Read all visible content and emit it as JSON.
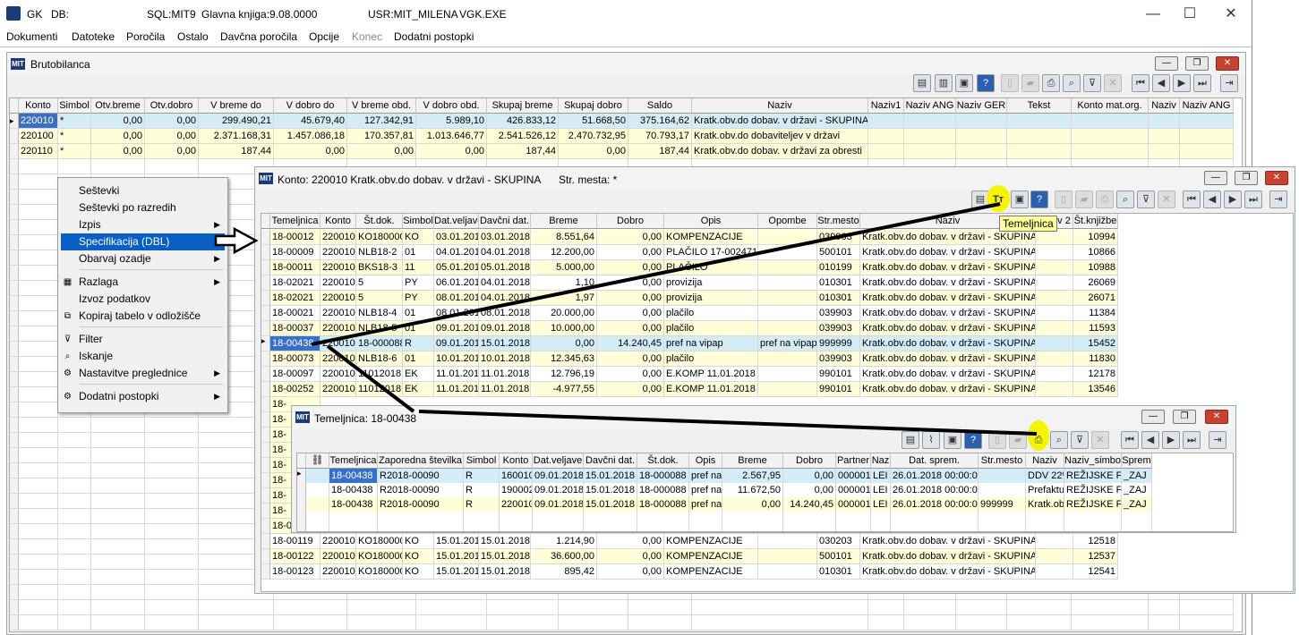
{
  "app": {
    "title_app": "GK",
    "title_db": "DB:",
    "title_sql": "SQL:MIT9",
    "title_ledger": "Glavna knjiga:9.08.0000",
    "title_user": "USR:MIT_MILENA",
    "title_exe": "VGK.EXE",
    "minimize": "—",
    "maximize": "☐",
    "close": "✕"
  },
  "menu": [
    "Dokumenti",
    "Datoteke",
    "Poročila",
    "Ostalo",
    "Davčna poročila",
    "Opcije",
    "Konec",
    "Dodatni postopki"
  ],
  "bruto": {
    "title": "Brutobilanca",
    "columns": [
      "Konto",
      "Simbol",
      "Otv.breme",
      "Otv.dobro",
      "V breme do",
      "V dobro do",
      "V breme obd.",
      "V dobro obd.",
      "Skupaj breme",
      "Skupaj dobro",
      "Saldo",
      "Naziv",
      "Naziv1",
      "Naziv ANG",
      "Naziv GER",
      "Tekst",
      "Konto mat.org.",
      "Naziv",
      "Naziv ANG"
    ],
    "rows": [
      [
        "220010",
        "*",
        "0,00",
        "0,00",
        "299.490,21",
        "45.679,40",
        "127.342,91",
        "5.989,10",
        "426.833,12",
        "51.668,50",
        "375.164,62",
        "Kratk.obv.do dobav. v državi - SKUPINA"
      ],
      [
        "220100",
        "*",
        "0,00",
        "0,00",
        "2.371.168,31",
        "1.457.086,18",
        "170.357,81",
        "1.013.646,77",
        "2.541.526,12",
        "2.470.732,95",
        "70.793,17",
        "Kratk.obv.do dobaviteljev v državi"
      ],
      [
        "220110",
        "*",
        "0,00",
        "0,00",
        "187,44",
        "0,00",
        "0,00",
        "0,00",
        "187,44",
        "0,00",
        "187,44",
        "Kratk.obv.do dobav. v državi za obresti"
      ]
    ]
  },
  "context_menu": {
    "items": [
      "Seštevki",
      "Seštevki po razredih",
      "Izpis",
      "Specifikacija (DBL)",
      "Obarvaj ozadje",
      "Razlaga",
      "Izvoz podatkov",
      "Kopiraj tabelo v odložišče",
      "Filter",
      "Iskanje",
      "Nastavitve preglednice",
      "Dodatni postopki"
    ]
  },
  "konto": {
    "title": "Konto: 220010 Kratk.obv.do dobav. v državi - SKUPINA",
    "str_mesta": "Str. mesta: *",
    "tooltip": "Temeljnica",
    "columns": [
      "Temeljnica",
      "Konto",
      "Št.dok.",
      "Simbol",
      "Dat.veljave",
      "Davčni dat.",
      "Breme",
      "Dobro",
      "Opis",
      "Opombe",
      "Str.mesto",
      "Naziv",
      "Naziv 2",
      "Št.knjižbe"
    ],
    "rows": [
      [
        "18-00012",
        "220010",
        "KO18000001",
        "KO",
        "03.01.2018",
        "03.01.2018",
        "8.551,64",
        "0,00",
        "KOMPENZACIJE",
        "",
        "039903",
        "Kratk.obv.do dobav. v državi - SKUPINA",
        "",
        "10994"
      ],
      [
        "18-00009",
        "220010",
        "NLB18-2",
        "01",
        "04.01.2018",
        "04.01.2018",
        "12.200,00",
        "0,00",
        "PLAČILO 17-002471",
        "",
        "500101",
        "Kratk.obv.do dobav. v državi - SKUPINA",
        "",
        "10866"
      ],
      [
        "18-00011",
        "220010",
        "BKS18-3",
        "11",
        "05.01.2018",
        "05.01.2018",
        "5.000,00",
        "0,00",
        "PLAČILO",
        "",
        "010199",
        "Kratk.obv.do dobav. v državi - SKUPINA",
        "",
        "10988"
      ],
      [
        "18-02021",
        "220010",
        "5",
        "PY",
        "06.01.2018",
        "04.01.2018",
        "1,10",
        "0,00",
        "provizija",
        "",
        "010301",
        "Kratk.obv.do dobav. v državi - SKUPINA",
        "",
        "26069"
      ],
      [
        "18-02021",
        "220010",
        "5",
        "PY",
        "08.01.2018",
        "04.01.2018",
        "1,97",
        "0,00",
        "provizija",
        "",
        "010301",
        "Kratk.obv.do dobav. v državi - SKUPINA",
        "",
        "26071"
      ],
      [
        "18-00021",
        "220010",
        "NLB18-4",
        "01",
        "08.01.2018",
        "08.01.2018",
        "20.000,00",
        "0,00",
        "plačilo",
        "",
        "039903",
        "Kratk.obv.do dobav. v državi - SKUPINA",
        "",
        "11384"
      ],
      [
        "18-00037",
        "220010",
        "NLB18-5",
        "01",
        "09.01.2018",
        "09.01.2018",
        "10.000,00",
        "0,00",
        "plačilo",
        "",
        "039903",
        "Kratk.obv.do dobav. v državi - SKUPINA",
        "",
        "11593"
      ],
      [
        "18-00438",
        "220010",
        "18-000088",
        "R",
        "09.01.2018",
        "15.01.2018",
        "0,00",
        "14.240,45",
        "pref na vipap",
        "pref na vipap",
        "999999",
        "Kratk.obv.do dobav. v državi - SKUPINA",
        "",
        "15452"
      ],
      [
        "18-00073",
        "220010",
        "NLB18-6",
        "01",
        "10.01.2018",
        "10.01.2018",
        "12.345,63",
        "0,00",
        "plačilo",
        "",
        "039903",
        "Kratk.obv.do dobav. v državi - SKUPINA",
        "",
        "11830"
      ],
      [
        "18-00097",
        "220010",
        "11012018",
        "EK",
        "11.01.2018",
        "11.01.2018",
        "12.796,19",
        "0,00",
        "E.KOMP 11.01.2018",
        "",
        "990101",
        "Kratk.obv.do dobav. v državi - SKUPINA",
        "",
        "12178"
      ],
      [
        "18-00252",
        "220010",
        "11012018",
        "EK",
        "11.01.2018",
        "11.01.2018",
        "-4.977,55",
        "0,00",
        "E.KOMP 11.01.2018",
        "",
        "990101",
        "Kratk.obv.do dobav. v državi - SKUPINA",
        "",
        "13546"
      ]
    ],
    "rows_bottom": [
      [
        "18-00119",
        "220010",
        "KO18000065",
        "KO",
        "15.01.2018",
        "15.01.2018",
        "1.138,76",
        "0,00",
        "KOMPENZACIJE",
        "",
        "010703",
        "Kratk.obv.do dobav. v državi - SKUPINA",
        "",
        "12516"
      ],
      [
        "18-00119",
        "220010",
        "KO18000065",
        "KO",
        "15.01.2018",
        "15.01.2018",
        "1.214,90",
        "0,00",
        "KOMPENZACIJE",
        "",
        "030203",
        "Kratk.obv.do dobav. v državi - SKUPINA",
        "",
        "12518"
      ],
      [
        "18-00122",
        "220010",
        "KO18000067",
        "KO",
        "15.01.2018",
        "15.01.2018",
        "36.600,00",
        "0,00",
        "KOMPENZACIJE",
        "",
        "500101",
        "Kratk.obv.do dobav. v državi - SKUPINA",
        "",
        "12537"
      ],
      [
        "18-00123",
        "220010",
        "KO18000068",
        "KO",
        "15.01.2018",
        "15.01.2018",
        "895,42",
        "0,00",
        "KOMPENZACIJE",
        "",
        "010301",
        "Kratk.obv.do dobav. v državi - SKUPINA",
        "",
        "12541"
      ]
    ],
    "stub_rows": [
      "18-",
      "18-",
      "18-",
      "18-",
      "18-",
      "18-",
      "18-",
      "18-"
    ]
  },
  "temeljnica": {
    "title": "Temeljnica: 18-00438",
    "columns": [
      "Temeljnica",
      "Zaporedna številka",
      "Simbol",
      "Konto",
      "Dat.veljave",
      "Davčni dat.",
      "Št.dok.",
      "Opis",
      "Breme",
      "Dobro",
      "Partner",
      "Naz",
      "Dat. sprem.",
      "Str.mesto",
      "Naziv",
      "Naziv_simbola",
      "Sprem"
    ],
    "rows": [
      [
        "18-00438",
        "R2018-00090",
        "R",
        "160010",
        "09.01.2018",
        "15.01.2018",
        "18-000088",
        "pref na",
        "2.567,95",
        "0,00",
        "0000012",
        "LEI",
        "26.01.2018 00:00:00",
        "",
        "DDV 22%",
        "REŽIJSKE FAKTURE",
        "_ZAJ"
      ],
      [
        "18-00438",
        "R2018-00090",
        "R",
        "190002",
        "09.01.2018",
        "15.01.2018",
        "18-000088",
        "pref na",
        "11.672,50",
        "0,00",
        "0000012",
        "LEI",
        "26.01.2018 00:00:00",
        "",
        "Prefaktur",
        "REŽIJSKE FAKTURE",
        "_ZAJ"
      ],
      [
        "18-00438",
        "R2018-00090",
        "R",
        "220010",
        "09.01.2018",
        "15.01.2018",
        "18-000088",
        "pref na",
        "0,00",
        "14.240,45",
        "0000012",
        "LEI",
        "26.01.2018 00:00:00",
        "999999",
        "Kratk.obv",
        "REŽIJSKE FAKTURE",
        "_ZAJ"
      ]
    ]
  },
  "colors": {
    "selection": "#3a6fc8",
    "row_yellow": "#fefed8",
    "row_selected": "#d4ecf6",
    "menu_highlight": "#0a5fc4",
    "annotation_yellow": "#f6f500"
  }
}
